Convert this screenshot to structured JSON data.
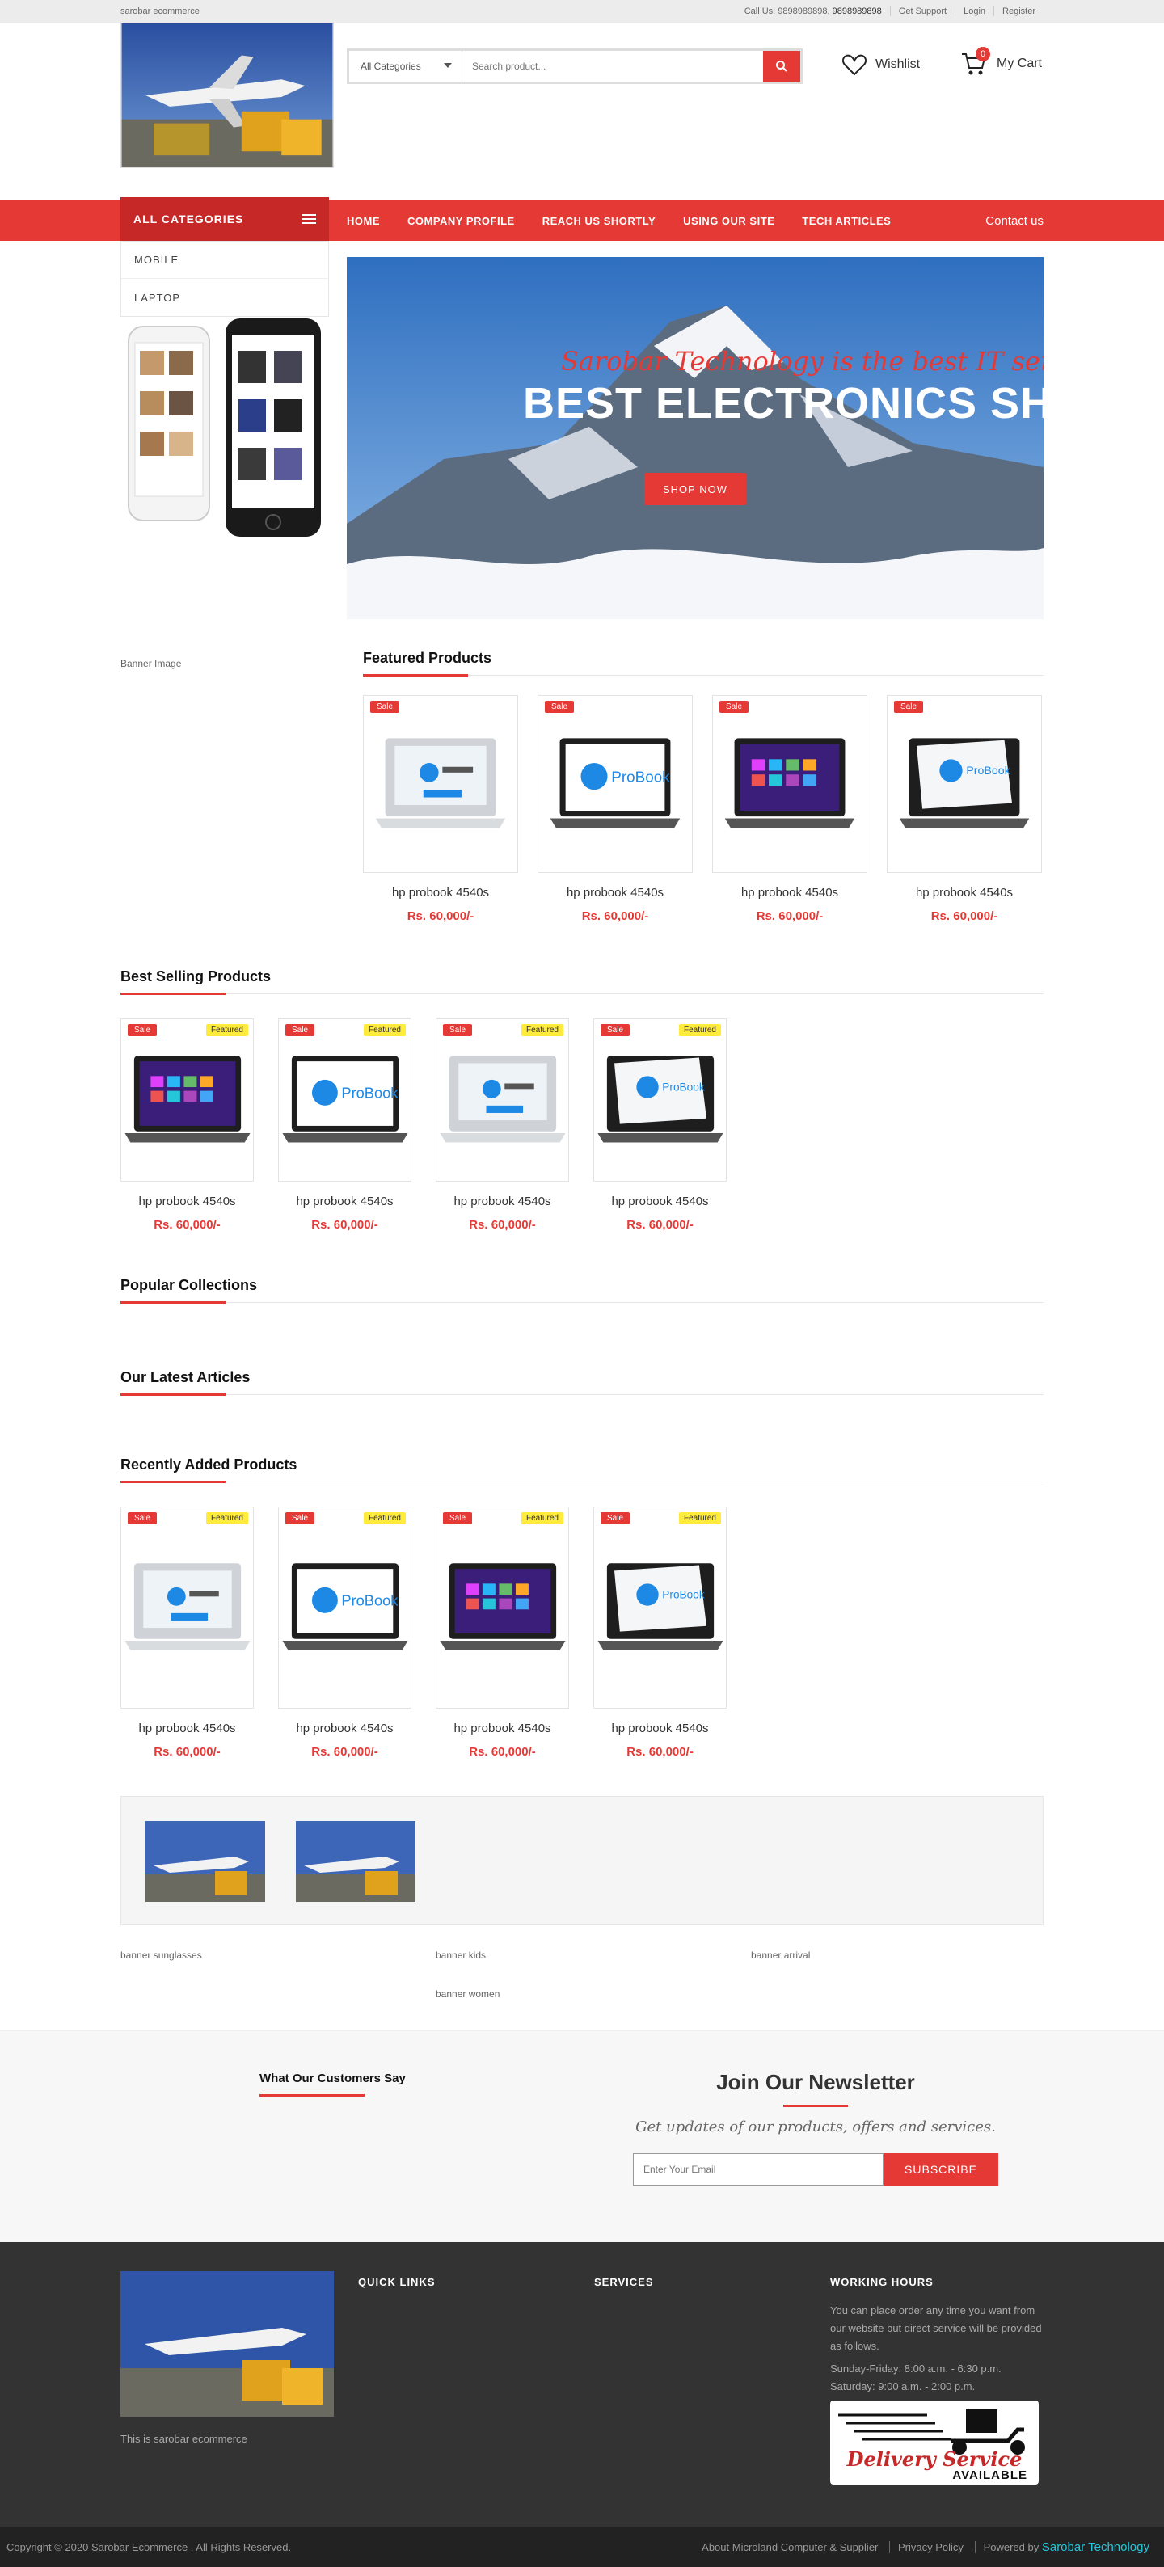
{
  "topbar": {
    "site": "sarobar ecommerce",
    "call_label": "Call Us: 9898989898,",
    "call_extra": "9898989898",
    "support": "Get Support",
    "login": "Login",
    "register": "Register"
  },
  "search": {
    "category": "All Categories",
    "placeholder": "Search product..."
  },
  "header": {
    "wishlist": "Wishlist",
    "cart": "My Cart",
    "cart_count": "0"
  },
  "nav": {
    "all_categories": "ALL CATEGORIES",
    "links": [
      "HOME",
      "COMPANY PROFILE",
      "REACH US SHORTLY",
      "USING OUR SITE",
      "TECH ARTICLES"
    ],
    "contact": "Contact us"
  },
  "categories": [
    "MOBILE",
    "LAPTOP"
  ],
  "slider": {
    "tagline": "Sarobar Technology is the best IT service provider",
    "headline": "BEST ELECTRONICS SHOP",
    "button": "SHOP NOW"
  },
  "banner_alt": "Banner Image",
  "featured": {
    "title": "Featured Products",
    "items": [
      {
        "name": "hp probook 4540s",
        "price": "Rs. 60,000/-",
        "sale": "Sale",
        "img": "pavilion"
      },
      {
        "name": "hp probook 4540s",
        "price": "Rs. 60,000/-",
        "sale": "Sale",
        "img": "probook"
      },
      {
        "name": "hp probook 4540s",
        "price": "Rs. 60,000/-",
        "sale": "Sale",
        "img": "windows"
      },
      {
        "name": "hp probook 4540s",
        "price": "Rs. 60,000/-",
        "sale": "Sale",
        "img": "angled"
      }
    ]
  },
  "best_selling": {
    "title": "Best Selling Products",
    "items": [
      {
        "name": "hp probook 4540s",
        "price": "Rs. 60,000/-",
        "sale": "Sale",
        "featured": "Featured",
        "img": "windows"
      },
      {
        "name": "hp probook 4540s",
        "price": "Rs. 60,000/-",
        "sale": "Sale",
        "featured": "Featured",
        "img": "probook"
      },
      {
        "name": "hp probook 4540s",
        "price": "Rs. 60,000/-",
        "sale": "Sale",
        "featured": "Featured",
        "img": "pavilion"
      },
      {
        "name": "hp probook 4540s",
        "price": "Rs. 60,000/-",
        "sale": "Sale",
        "featured": "Featured",
        "img": "angled"
      }
    ]
  },
  "popular_title": "Popular Collections",
  "articles_title": "Our Latest Articles",
  "recent": {
    "title": "Recently Added Products",
    "items": [
      {
        "name": "hp probook 4540s",
        "price": "Rs. 60,000/-",
        "sale": "Sale",
        "featured": "Featured",
        "img": "pavilion"
      },
      {
        "name": "hp probook 4540s",
        "price": "Rs. 60,000/-",
        "sale": "Sale",
        "featured": "Featured",
        "img": "probook"
      },
      {
        "name": "hp probook 4540s",
        "price": "Rs. 60,000/-",
        "sale": "Sale",
        "featured": "Featured",
        "img": "windows"
      },
      {
        "name": "hp probook 4540s",
        "price": "Rs. 60,000/-",
        "sale": "Sale",
        "featured": "Featured",
        "img": "angled"
      }
    ]
  },
  "banners": {
    "sunglasses": "banner sunglasses",
    "kids": "banner kids",
    "arrival": "banner arrival",
    "women": "banner women"
  },
  "testimonials_title": "What Our Customers Say",
  "newsletter": {
    "title": "Join Our Newsletter",
    "subtitle": "Get updates of our products, offers and services.",
    "placeholder": "Enter Your Email",
    "button": "SUBSCRIBE"
  },
  "footer": {
    "about": "This is sarobar ecommerce",
    "quick_links": "QUICK LINKS",
    "services": "SERVICES",
    "working_hours": "WORKING HOURS",
    "hours_text": "You can place order any time you want from our website but direct service will be provided as follows.",
    "weekday": "Sunday-Friday: 8:00 a.m. - 6:30 p.m.",
    "saturday": "Saturday: 9:00 a.m. - 2:00 p.m.",
    "delivery_line1": "Delivery Service",
    "delivery_line2": "AVAILABLE"
  },
  "copyright": {
    "text": "Copyright © 2020 Sarobar Ecommerce . All Rights Reserved.",
    "about": "About Microland Computer & Supplier",
    "privacy": "Privacy Policy",
    "powered": "Powered by",
    "brand": "Sarobar Technology"
  },
  "colors": {
    "accent": "#e53935",
    "dark": "#333333",
    "footer_link": "#26c6da"
  }
}
